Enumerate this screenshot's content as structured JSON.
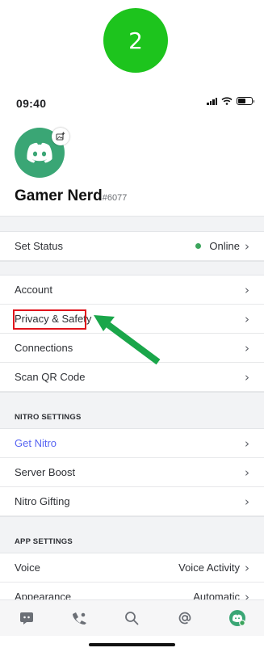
{
  "step_badge": "2",
  "status_bar": {
    "time": "09:40"
  },
  "profile": {
    "username": "Gamer Nerd",
    "discriminator": "#6077"
  },
  "set_status": {
    "label": "Set Status",
    "value": "Online"
  },
  "account_items": [
    {
      "label": "Account"
    },
    {
      "label": "Privacy & Safety"
    },
    {
      "label": "Connections"
    },
    {
      "label": "Scan QR Code"
    }
  ],
  "nitro_settings": {
    "header": "NITRO SETTINGS",
    "items": [
      {
        "label": "Get Nitro"
      },
      {
        "label": "Server Boost"
      },
      {
        "label": "Nitro Gifting"
      }
    ]
  },
  "app_settings": {
    "header": "APP SETTINGS",
    "items": [
      {
        "label": "Voice",
        "value": "Voice Activity"
      },
      {
        "label": "Appearance",
        "value": "Automatic"
      }
    ]
  },
  "tabbar": {
    "tabs": [
      "home-icon",
      "friends-icon",
      "search-icon",
      "mentions-icon",
      "profile-icon"
    ]
  },
  "colors": {
    "step_badge": "#1dc41d",
    "avatar": "#3aa675",
    "online": "#3ba55c",
    "link": "#5865f2",
    "highlight": "#e1141c",
    "arrow": "#1aa64a"
  }
}
